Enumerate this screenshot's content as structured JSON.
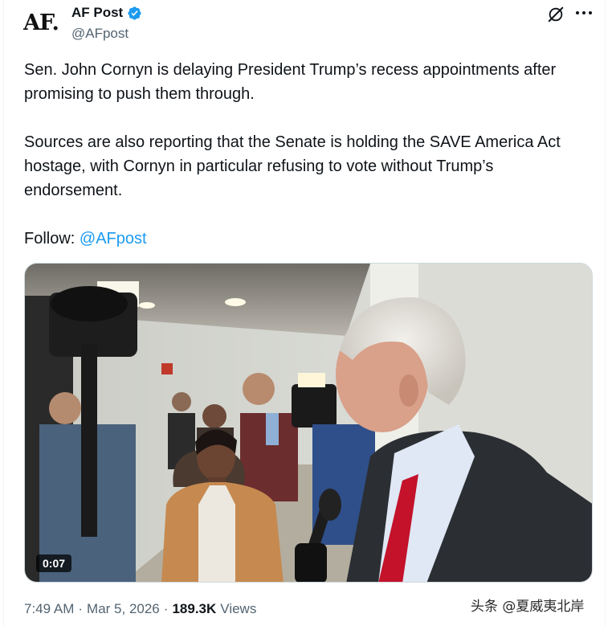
{
  "author": {
    "logo_text": "AF.",
    "display_name": "AF Post",
    "handle": "@AFpost",
    "verified": true,
    "verified_color": "#1d9bf0"
  },
  "tweet": {
    "paragraph1": "Sen. John Cornyn is delaying President Trump’s recess appointments after promising to push them through.",
    "paragraph2": "Sources are also reporting that the Senate is holding the SAVE America Act hostage, with Cornyn in particular refusing to vote without Trump’s endorsement.",
    "follow_label": "Follow: ",
    "follow_mention": "@AFpost"
  },
  "media": {
    "type": "video",
    "duration": "0:07"
  },
  "meta": {
    "time": "7:49 AM",
    "separator": "·",
    "date": "Mar 5, 2026",
    "views_count": "189.3K",
    "views_label": "Views"
  },
  "watermark": "头条 @夏威夷北岸",
  "icons": {
    "grok": "grok-slash-icon",
    "more": "more-dots-icon",
    "verified": "verified-badge-icon"
  },
  "colors": {
    "accent": "#1d9bf0",
    "text": "#0f1419",
    "secondary": "#536471"
  }
}
